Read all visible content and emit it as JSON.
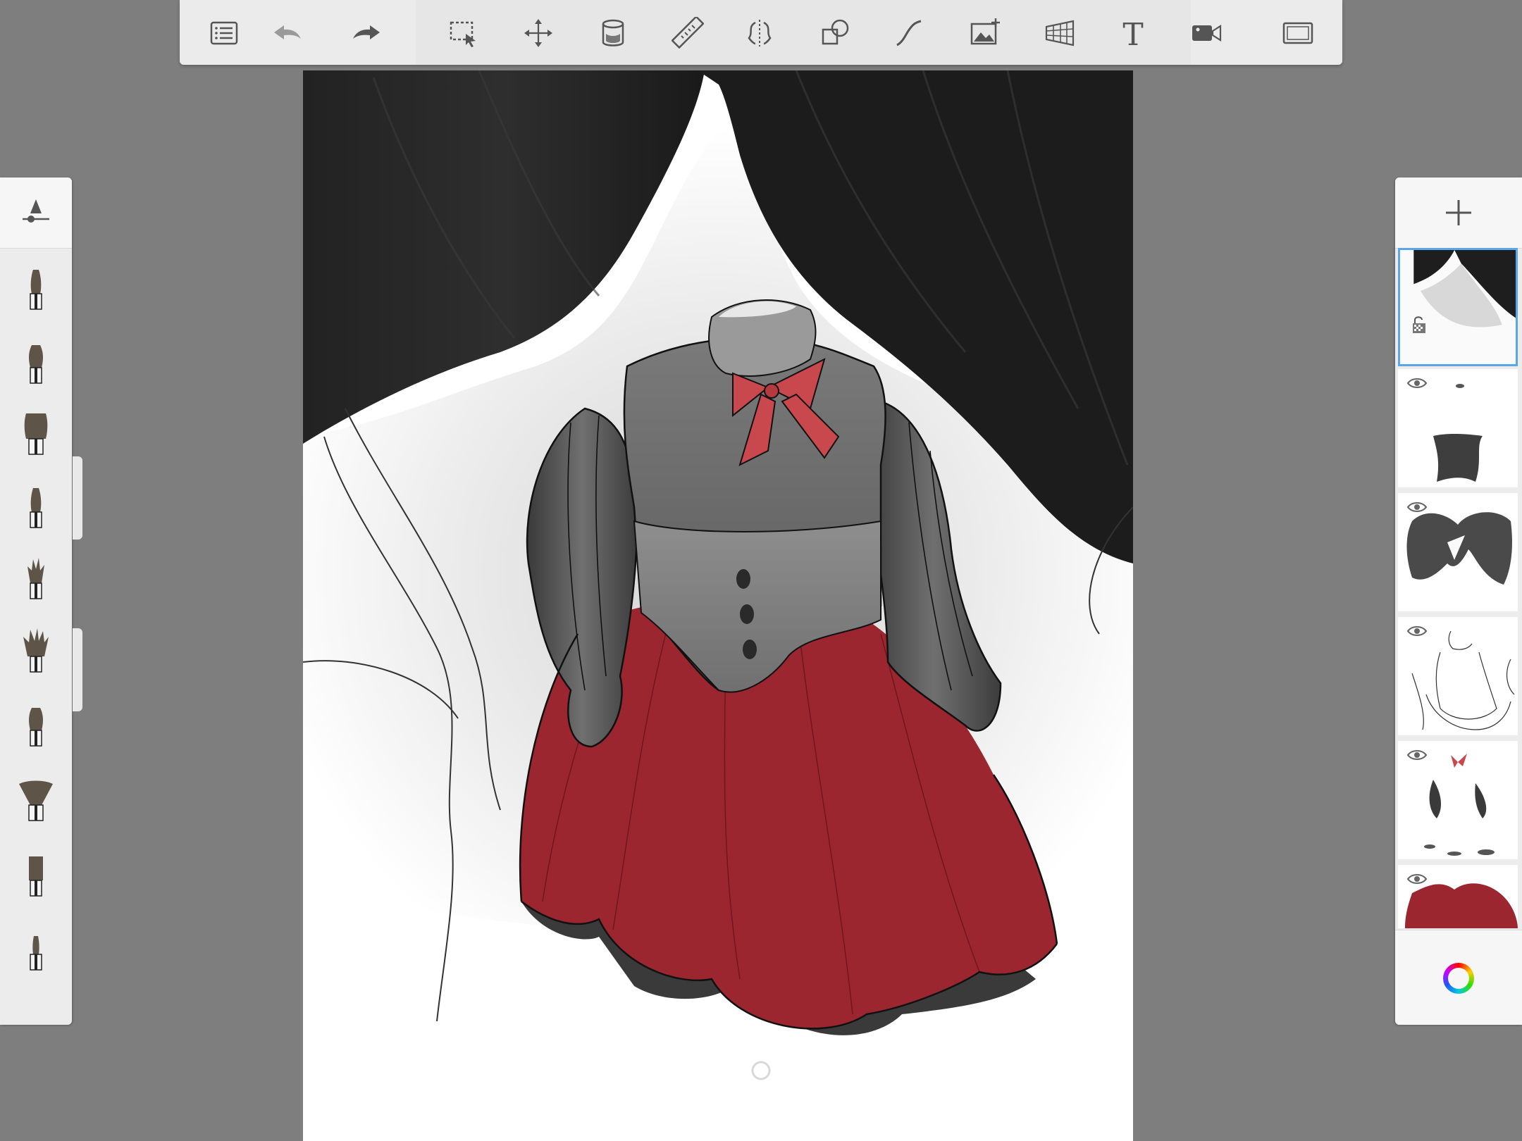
{
  "toolbar": {
    "groups": [
      {
        "items": [
          {
            "name": "list-icon"
          },
          {
            "name": "undo-icon"
          },
          {
            "name": "redo-icon"
          }
        ]
      },
      {
        "items": [
          {
            "name": "selection-icon"
          },
          {
            "name": "transform-icon"
          },
          {
            "name": "fill-bucket-icon"
          },
          {
            "name": "ruler-icon"
          },
          {
            "name": "symmetry-icon"
          },
          {
            "name": "shapes-icon"
          },
          {
            "name": "curve-icon"
          },
          {
            "name": "add-image-icon"
          },
          {
            "name": "perspective-grid-icon"
          },
          {
            "name": "text-icon",
            "glyph": "T"
          },
          {
            "name": "time-lapse-icon"
          }
        ]
      },
      {
        "items": [
          {
            "name": "fullscreen-icon"
          }
        ]
      }
    ]
  },
  "brushes": {
    "header_icon": "brush-properties-icon",
    "items": [
      {
        "name": "pencil-brush",
        "shape": "narrow"
      },
      {
        "name": "round-brush",
        "shape": "medium"
      },
      {
        "name": "flat-brush",
        "shape": "wide"
      },
      {
        "name": "marker-brush",
        "shape": "narrow"
      },
      {
        "name": "spiky-brush",
        "shape": "spiky"
      },
      {
        "name": "large-spiky-brush",
        "shape": "spiky-large"
      },
      {
        "name": "filbert-brush",
        "shape": "medium"
      },
      {
        "name": "fan-brush",
        "shape": "fan"
      },
      {
        "name": "square-brush",
        "shape": "square"
      },
      {
        "name": "fine-brush",
        "shape": "fine"
      }
    ],
    "selected_index": null
  },
  "layers": {
    "add_icon": "plus-icon",
    "items": [
      {
        "name": "layer-background",
        "selected": true,
        "visible": true,
        "locked": true
      },
      {
        "name": "layer-shadows",
        "selected": false,
        "visible": true,
        "locked": false
      },
      {
        "name": "layer-bodice-texture",
        "selected": false,
        "visible": true,
        "locked": false
      },
      {
        "name": "layer-lineart",
        "selected": false,
        "visible": true,
        "locked": false
      },
      {
        "name": "layer-accents",
        "selected": false,
        "visible": true,
        "locked": false
      },
      {
        "name": "layer-skirt-red",
        "selected": false,
        "visible": true,
        "locked": false
      }
    ],
    "footer_icon": "color-wheel-icon"
  },
  "colors": {
    "skirt_red": "#9b2630",
    "bow_red": "#c9484e",
    "selection_blue": "#5aa6e8",
    "curtain_dark": "#1d1d1d"
  }
}
